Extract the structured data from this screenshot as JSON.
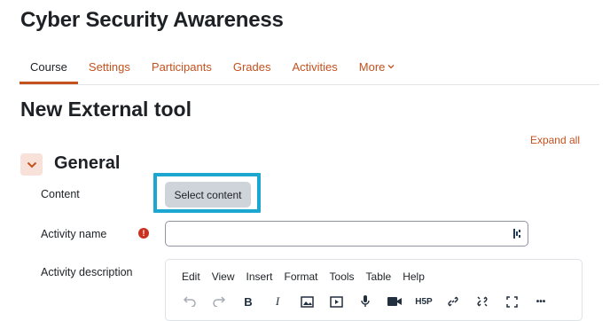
{
  "course": {
    "title": "Cyber Security Awareness"
  },
  "nav": {
    "tabs": [
      {
        "label": "Course",
        "active": true
      },
      {
        "label": "Settings"
      },
      {
        "label": "Participants"
      },
      {
        "label": "Grades"
      },
      {
        "label": "Activities"
      },
      {
        "label": "More"
      }
    ]
  },
  "page": {
    "heading": "New External tool",
    "expand_all": "Expand all"
  },
  "section": {
    "title": "General",
    "content_label": "Content",
    "select_content_button": "Select content",
    "activity_name_label": "Activity name",
    "activity_name_value": "",
    "activity_description_label": "Activity description"
  },
  "editor": {
    "menu": [
      "Edit",
      "View",
      "Insert",
      "Format",
      "Tools",
      "Table",
      "Help"
    ],
    "toolbar": {
      "bold": "B",
      "italic": "I",
      "h5p": "H5P",
      "more": "•••"
    }
  },
  "colors": {
    "accent": "#c4511e",
    "highlight": "#1ba7cf",
    "required": "#ca3120"
  }
}
